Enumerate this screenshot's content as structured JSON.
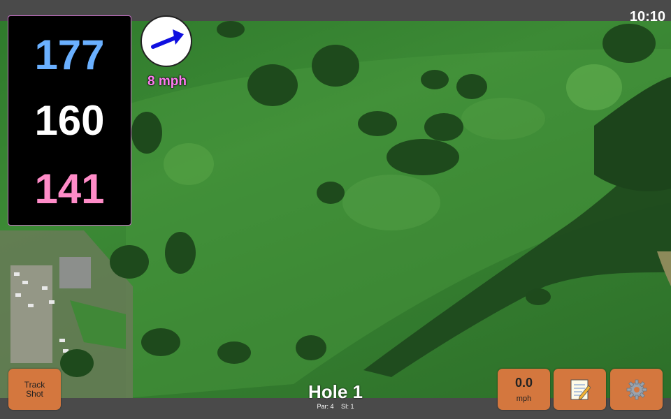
{
  "status_bar": {
    "time": "10:10"
  },
  "distances": {
    "back": "177",
    "middle": "160",
    "front": "141"
  },
  "wind": {
    "speed": "8 mph",
    "arrow_color": "#1010e0"
  },
  "hole": {
    "title": "Hole 1",
    "par": "Par: 4",
    "si": "SI: 1"
  },
  "buttons": {
    "track_shot": "Track\nShot",
    "speed_value": "0.0",
    "speed_unit": "mph",
    "scorecard_icon": "memo-icon",
    "settings_icon": "gear-icon"
  },
  "colors": {
    "button_bg": "#d4773e",
    "back_distance": "#6ab0ff",
    "middle_distance": "#ffffff",
    "front_distance": "#ff8cc8",
    "wind_text": "#ff7cf0"
  }
}
